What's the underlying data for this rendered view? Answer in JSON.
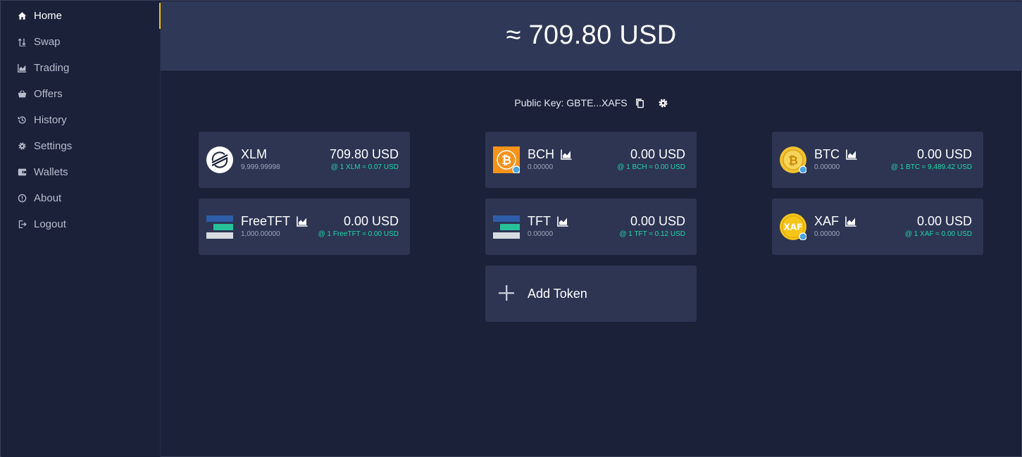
{
  "sidebar": {
    "items": [
      {
        "label": "Home",
        "icon": "home-icon",
        "active": true
      },
      {
        "label": "Swap",
        "icon": "swap-icon"
      },
      {
        "label": "Trading",
        "icon": "chart-area-icon"
      },
      {
        "label": "Offers",
        "icon": "basket-icon"
      },
      {
        "label": "History",
        "icon": "history-icon"
      },
      {
        "label": "Settings",
        "icon": "gear-icon"
      },
      {
        "label": "Wallets",
        "icon": "wallet-icon"
      },
      {
        "label": "About",
        "icon": "info-icon"
      },
      {
        "label": "Logout",
        "icon": "logout-icon"
      }
    ]
  },
  "header": {
    "balance": "≈ 709.80 USD"
  },
  "account": {
    "public_key_label": "Public Key: GBTE...XAFS"
  },
  "tokens": [
    {
      "name": "XLM",
      "amount": "9,999.99998",
      "value": "709.80 USD",
      "rate": "@ 1 XLM ≈ 0.07 USD",
      "icon": "stellar-logo-icon",
      "chart": false
    },
    {
      "name": "BCH",
      "amount": "0.00000",
      "value": "0.00 USD",
      "rate": "@ 1 BCH ≈ 0.00 USD",
      "icon": "bitcoin-cash-logo-icon",
      "chart": true
    },
    {
      "name": "BTC",
      "amount": "0.00000",
      "value": "0.00 USD",
      "rate": "@ 1 BTC ≈ 9,489.42 USD",
      "icon": "bitcoin-coin-icon",
      "chart": true
    },
    {
      "name": "FreeTFT",
      "amount": "1,000.00000",
      "value": "0.00 USD",
      "rate": "@ 1 FreeTFT ≈ 0.00 USD",
      "icon": "threefold-logo-icon",
      "chart": true
    },
    {
      "name": "TFT",
      "amount": "0.00000",
      "value": "0.00 USD",
      "rate": "@ 1 TFT ≈ 0.12 USD",
      "icon": "threefold-logo-icon",
      "chart": true
    },
    {
      "name": "XAF",
      "amount": "0.00000",
      "value": "0.00 USD",
      "rate": "@ 1 XAF ≈ 0.00 USD",
      "icon": "xaf-coin-icon",
      "chart": true
    }
  ],
  "add_token": {
    "label": "Add Token"
  },
  "colors": {
    "background": "#1b2139",
    "header": "#2f3856",
    "card": "#2d3553",
    "accent": "#f6c20f",
    "rate": "#21d6a7"
  }
}
